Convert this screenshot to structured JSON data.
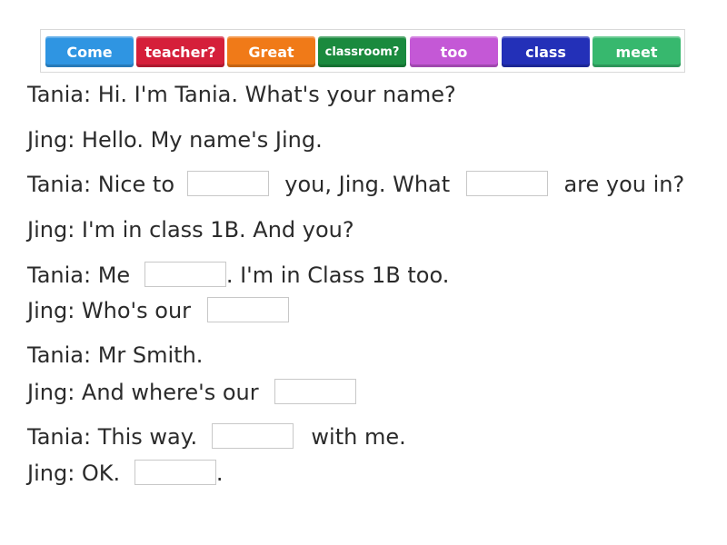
{
  "word_bank": {
    "tiles": [
      {
        "label": "Come",
        "color": "#2f95e2"
      },
      {
        "label": "teacher?",
        "color": "#d51f3a"
      },
      {
        "label": "Great",
        "color": "#f07a18"
      },
      {
        "label": "classroom?",
        "color": "#1a8a3e"
      },
      {
        "label": "too",
        "color": "#c458d6"
      },
      {
        "label": "class",
        "color": "#2330b8"
      },
      {
        "label": "meet",
        "color": "#37b86e"
      }
    ]
  },
  "dialogue": {
    "l1": "Tania: Hi. I'm Tania. What's your name?",
    "l2": "Jing: Hello. My name's  Jing.",
    "l3a": "Tania: Nice to",
    "l3b": "you,  Jing. What",
    "l3c": "are you in?",
    "l4": "Jing: I'm in class 1B. And you?",
    "l5a": "Tania: Me",
    "l5b": ". I'm in Class 1B too.",
    "l6a": "Jing: Who's our",
    "l7": "Tania: Mr Smith.",
    "l8a": "Jing: And where's our",
    "l9a": "Tania: This way.",
    "l9b": "with me.",
    "l10a": "Jing: OK.",
    "l10b": "."
  }
}
